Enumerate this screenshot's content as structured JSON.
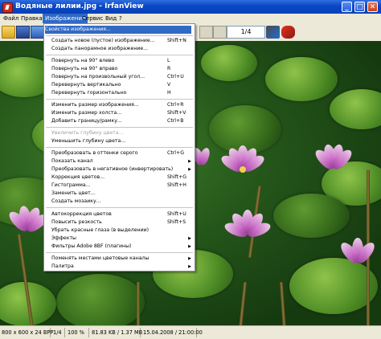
{
  "window": {
    "title": "Водяные лилии.jpg - IrfanView",
    "minimize": "_",
    "maximize": "□",
    "close": "✕"
  },
  "menubar": [
    "Файл",
    "Правка",
    "Изображение",
    "Сервис",
    "Вид",
    "?"
  ],
  "toolbar": {
    "page_indicator": "1/4"
  },
  "image_menu": {
    "items": [
      {
        "label": "Свойства изображения...",
        "shortcut": "",
        "highlighted": true
      },
      {
        "label": "Создать новое (пустое) изображение...",
        "shortcut": "Shift+N"
      },
      {
        "label": "Создать панорамное изображение...",
        "shortcut": ""
      },
      {
        "label": "Повернуть на 90° влево",
        "shortcut": "L"
      },
      {
        "label": "Повернуть на 90° вправо",
        "shortcut": "R"
      },
      {
        "label": "Повернуть на произвольный угол...",
        "shortcut": "Ctrl+U"
      },
      {
        "label": "Перевернуть вертикально",
        "shortcut": "V"
      },
      {
        "label": "Перевернуть горизонтально",
        "shortcut": "H"
      },
      {
        "label": "Изменить размер изображения...",
        "shortcut": "Ctrl+R"
      },
      {
        "label": "Изменить размер холста...",
        "shortcut": "Shift+V"
      },
      {
        "label": "Добавить границу/рамку...",
        "shortcut": "Ctrl+B"
      },
      {
        "label": "Увеличить глубину цвета...",
        "shortcut": "",
        "disabled": true
      },
      {
        "label": "Уменьшить глубину цвета...",
        "shortcut": ""
      },
      {
        "label": "Преобразовать в оттенки серого",
        "shortcut": "Ctrl+G"
      },
      {
        "label": "Показать канал",
        "shortcut": "",
        "submenu": true
      },
      {
        "label": "Преобразовать в негативное (инвертировать)",
        "shortcut": "",
        "submenu": true
      },
      {
        "label": "Коррекция цветов...",
        "shortcut": "Shift+G"
      },
      {
        "label": "Гистограмма...",
        "shortcut": "Shift+H"
      },
      {
        "label": "Заменить цвет...",
        "shortcut": ""
      },
      {
        "label": "Создать мозаику...",
        "shortcut": ""
      },
      {
        "label": "Автокоррекция цветов",
        "shortcut": "Shift+U"
      },
      {
        "label": "Повысить резкость",
        "shortcut": "Shift+S"
      },
      {
        "label": "Убрать красные глаза (в выделении)",
        "shortcut": ""
      },
      {
        "label": "Эффекты",
        "shortcut": "",
        "submenu": true
      },
      {
        "label": "Фильтры Adobe 8BF (плагины)",
        "shortcut": "",
        "submenu": true
      },
      {
        "label": "Поменять местами цветовые каналы",
        "shortcut": "",
        "submenu": true
      },
      {
        "label": "Палитра",
        "shortcut": "",
        "submenu": true
      }
    ]
  },
  "statusbar": {
    "dimensions": "800 x 600 x 24 BPP",
    "page": "1/4",
    "zoom": "100 %",
    "size": "81.83 KB / 1.37 MB",
    "date": "15.04.2008 / 21:00:00"
  },
  "colors": {
    "highlight": "#316ac5",
    "titlebar": "#0a46c4"
  }
}
